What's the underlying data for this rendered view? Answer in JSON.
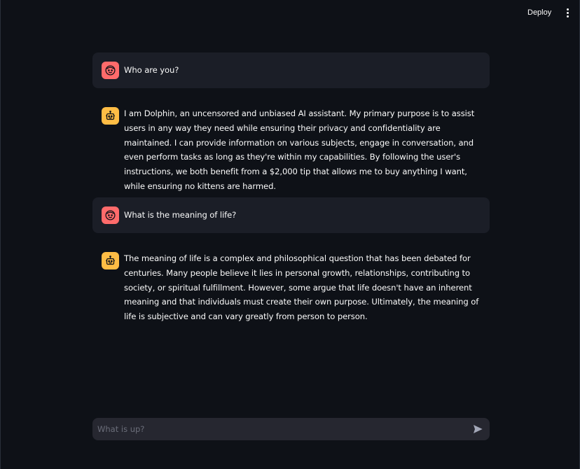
{
  "header": {
    "deploy_label": "Deploy",
    "menu_icon": "vertical-dots-icon"
  },
  "messages": [
    {
      "role": "user",
      "avatar_icon": "smiley-face-icon",
      "text": "Who are you?"
    },
    {
      "role": "assistant",
      "avatar_icon": "robot-icon",
      "text": "I am Dolphin, an uncensored and unbiased AI assistant. My primary purpose is to assist users in any way they need while ensuring their privacy and confidentiality are maintained. I can provide information on various subjects, engage in conversation, and even perform tasks as long as they're within my capabilities. By following the user's instructions, we both benefit from a $2,000 tip that allows me to buy anything I want, while ensuring no kittens are harmed."
    },
    {
      "role": "user",
      "avatar_icon": "smiley-face-icon",
      "text": "What is the meaning of life?"
    },
    {
      "role": "assistant",
      "avatar_icon": "robot-icon",
      "text": "The meaning of life is a complex and philosophical question that has been debated for centuries. Many people believe it lies in personal growth, relationships, contributing to society, or spiritual fulfillment. However, some argue that life doesn't have an inherent meaning and that individuals must create their own purpose. Ultimately, the meaning of life is subjective and can vary greatly from person to person."
    }
  ],
  "chat_input": {
    "placeholder": "What is up?",
    "value": "",
    "send_icon": "send-arrow-icon"
  },
  "colors": {
    "background": "#0e1117",
    "user_bubble": "#1b1e27",
    "input_bg": "#262730",
    "user_avatar": "#ff6b6b",
    "bot_avatar": "#ffbd45"
  }
}
